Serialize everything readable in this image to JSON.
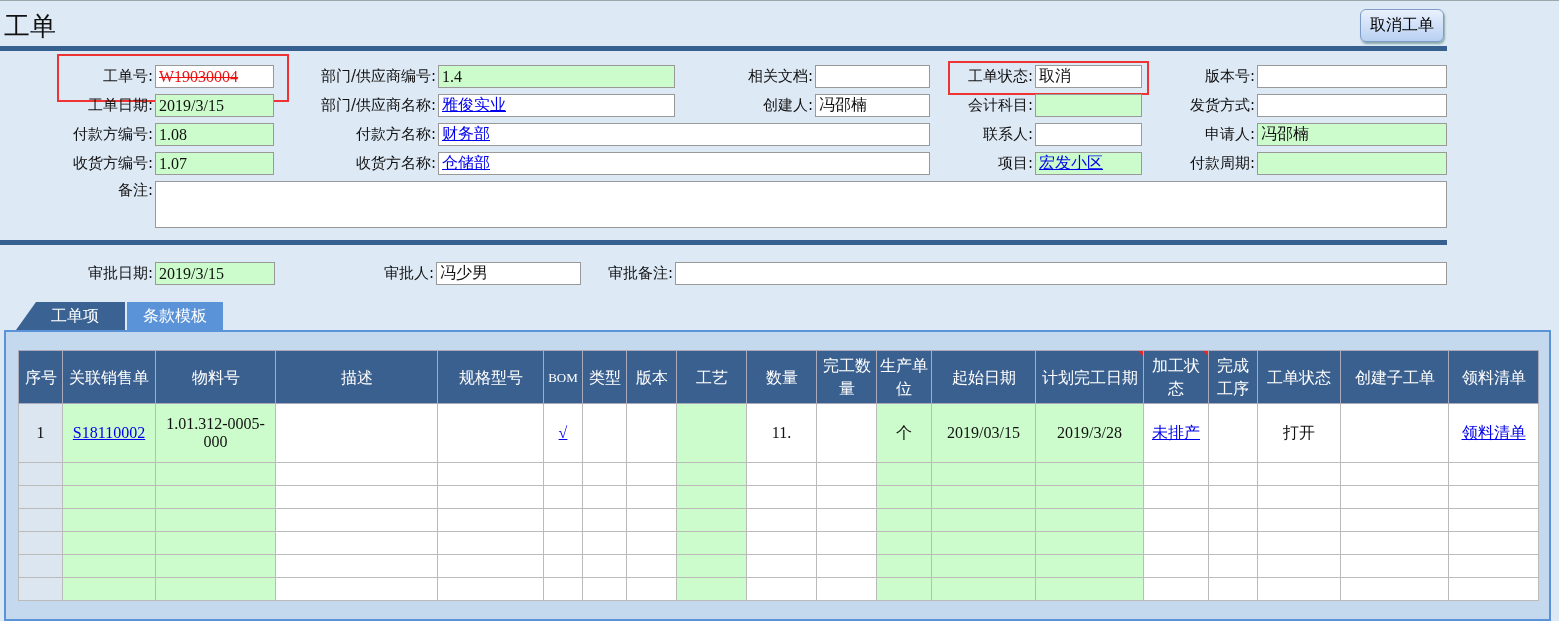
{
  "window": {
    "title": "工单"
  },
  "actions": [
    {
      "label": "取消工单"
    }
  ],
  "form": {
    "rows": [
      [
        {
          "label": "工单号:",
          "value": "W19030004",
          "readonly": false,
          "kind": "void",
          "highlighted": true
        },
        {
          "label": "部门/供应商编号:",
          "value": "1.4",
          "readonly": true,
          "kind": "plain"
        },
        {
          "label": "相关文档:",
          "readonly": false
        },
        {
          "label": "工单状态:",
          "value": "取消",
          "readonly": false,
          "kind": "plain",
          "highlighted": true
        },
        {
          "label": "版本号:",
          "readonly": false
        }
      ],
      [
        {
          "label": "工单日期:",
          "value": "2019/3/15",
          "readonly": true,
          "kind": "plain"
        },
        {
          "label": "部门/供应商名称:",
          "value": "雅俊实业",
          "readonly": false,
          "kind": "link"
        },
        {
          "label": "创建人:",
          "value": "冯邵楠",
          "readonly": false,
          "kind": "plain"
        },
        {
          "label": "会计科目:",
          "readonly": true
        },
        {
          "label": "发货方式:",
          "readonly": false
        }
      ],
      [
        {
          "label": "付款方编号:",
          "value": "1.08",
          "readonly": true,
          "kind": "plain"
        },
        {
          "label": "付款方名称:",
          "value": "财务部",
          "readonly": false,
          "kind": "link",
          "wide": true
        },
        {
          "label": "联系人:",
          "readonly": false
        },
        {
          "label": "申请人:",
          "value": "冯邵楠",
          "readonly": true,
          "kind": "plain"
        }
      ],
      [
        {
          "label": "收货方编号:",
          "value": "1.07",
          "readonly": true,
          "kind": "plain"
        },
        {
          "label": "收货方名称:",
          "value": "仓储部",
          "readonly": false,
          "kind": "link",
          "wide": true
        },
        {
          "label": "项目:",
          "value": "宏发小区",
          "readonly": true,
          "kind": "link"
        },
        {
          "label": "付款周期:",
          "readonly": true
        }
      ]
    ],
    "remarks": {
      "label": "备注:"
    }
  },
  "approval": [
    {
      "label": "审批日期:",
      "value": "2019/3/15",
      "readonly": true
    },
    {
      "label": "审批人:",
      "value": "冯少男",
      "readonly": false
    },
    {
      "label": "审批备注:",
      "readonly": false
    }
  ],
  "tabs": [
    {
      "label": "工单项",
      "selected": false
    },
    {
      "label": "条款模板",
      "selected": true
    }
  ],
  "table": {
    "columns": [
      {
        "label": "序号"
      },
      {
        "label": "关联销售单",
        "readonly": true
      },
      {
        "label": "物料号",
        "readonly": true
      },
      {
        "label": "描述",
        "readonly": false
      },
      {
        "label": "规格型号",
        "readonly": false
      },
      {
        "label": "BOM",
        "readonly": false
      },
      {
        "label": "类型",
        "readonly": false
      },
      {
        "label": "版本",
        "readonly": false
      },
      {
        "label": "工艺",
        "readonly": true
      },
      {
        "label": "数量",
        "readonly": false
      },
      {
        "label": "完工数量",
        "readonly": false
      },
      {
        "label": "生产单位",
        "readonly": true
      },
      {
        "label": "起始日期",
        "readonly": true
      },
      {
        "label": "计划完工日期",
        "readonly": true,
        "note_mark": true
      },
      {
        "label": "加工状态",
        "readonly": false,
        "note_mark": true
      },
      {
        "label": "完成工序",
        "readonly": false
      },
      {
        "label": "工单状态",
        "readonly": false
      },
      {
        "label": "创建子工单",
        "readonly": false
      },
      {
        "label": "领料清单",
        "readonly": false
      }
    ],
    "rows": [
      {
        "cells": [
          {
            "text": "1"
          },
          {
            "text": "S18110002",
            "link": true
          },
          {
            "text": "1.01.312-0005-000"
          },
          {},
          {},
          {
            "text": "√",
            "link": true
          },
          {},
          {},
          {},
          {
            "text": "11."
          },
          {},
          {
            "text": "个"
          },
          {
            "text": "2019/03/15"
          },
          {
            "text": "2019/3/28"
          },
          {
            "text": "未排产",
            "link": true
          },
          {},
          {
            "text": "打开"
          },
          {},
          {
            "text": "领料清单",
            "link": true
          }
        ]
      }
    ]
  }
}
